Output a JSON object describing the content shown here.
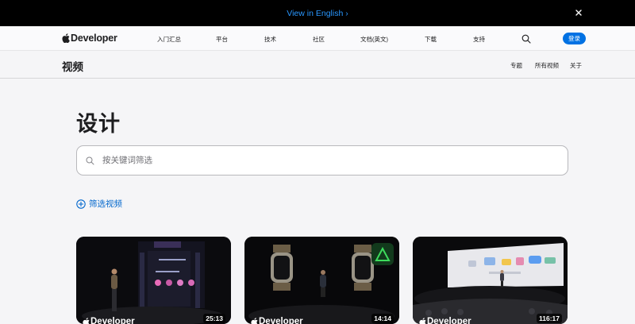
{
  "banner": {
    "link_text": "View in English ›"
  },
  "global_nav": {
    "brand": "Developer",
    "items": [
      "入门汇总",
      "平台",
      "技术",
      "社区",
      "文档(英文)",
      "下载",
      "支持"
    ],
    "login": "登录"
  },
  "local_nav": {
    "title": "视频",
    "items": [
      "专题",
      "所有视频",
      "关于"
    ]
  },
  "main": {
    "heading": "设计",
    "search_placeholder": "按关键词筛选",
    "filter_label": "筛选视频"
  },
  "videos": [
    {
      "brand": "Developer",
      "duration": "25:13"
    },
    {
      "brand": "Developer",
      "duration": "14:14"
    },
    {
      "brand": "Developer",
      "duration": "116:17"
    }
  ],
  "colors": {
    "accent": "#0071e3",
    "link": "#0066cc",
    "banner_link": "#2997ff",
    "page_bg": "#f5f5f7"
  }
}
